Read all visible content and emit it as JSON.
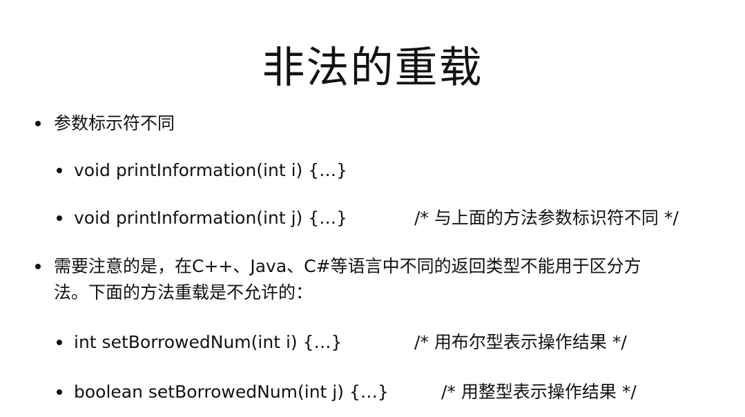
{
  "slide": {
    "title": "非法的重载",
    "bullets": [
      {
        "text": "参数标示符不同"
      },
      {
        "text": "void printInformation(int i) {…}"
      },
      {
        "text": "void printInformation(int j) {…}",
        "comment": "/* 与上面的方法参数标识符不同 */"
      },
      {
        "line1": "需要注意的是，在C++、Java、C#等语言中不同的返回类型不能用于区分方",
        "line2": "法。下面的方法重载是不允许的："
      },
      {
        "text": "int setBorrowedNum(int i) {…}",
        "comment": "/* 用布尔型表示操作结果 */"
      },
      {
        "text": "boolean setBorrowedNum(int j) {…}",
        "comment": "/* 用整型表示操作结果 */"
      }
    ]
  }
}
